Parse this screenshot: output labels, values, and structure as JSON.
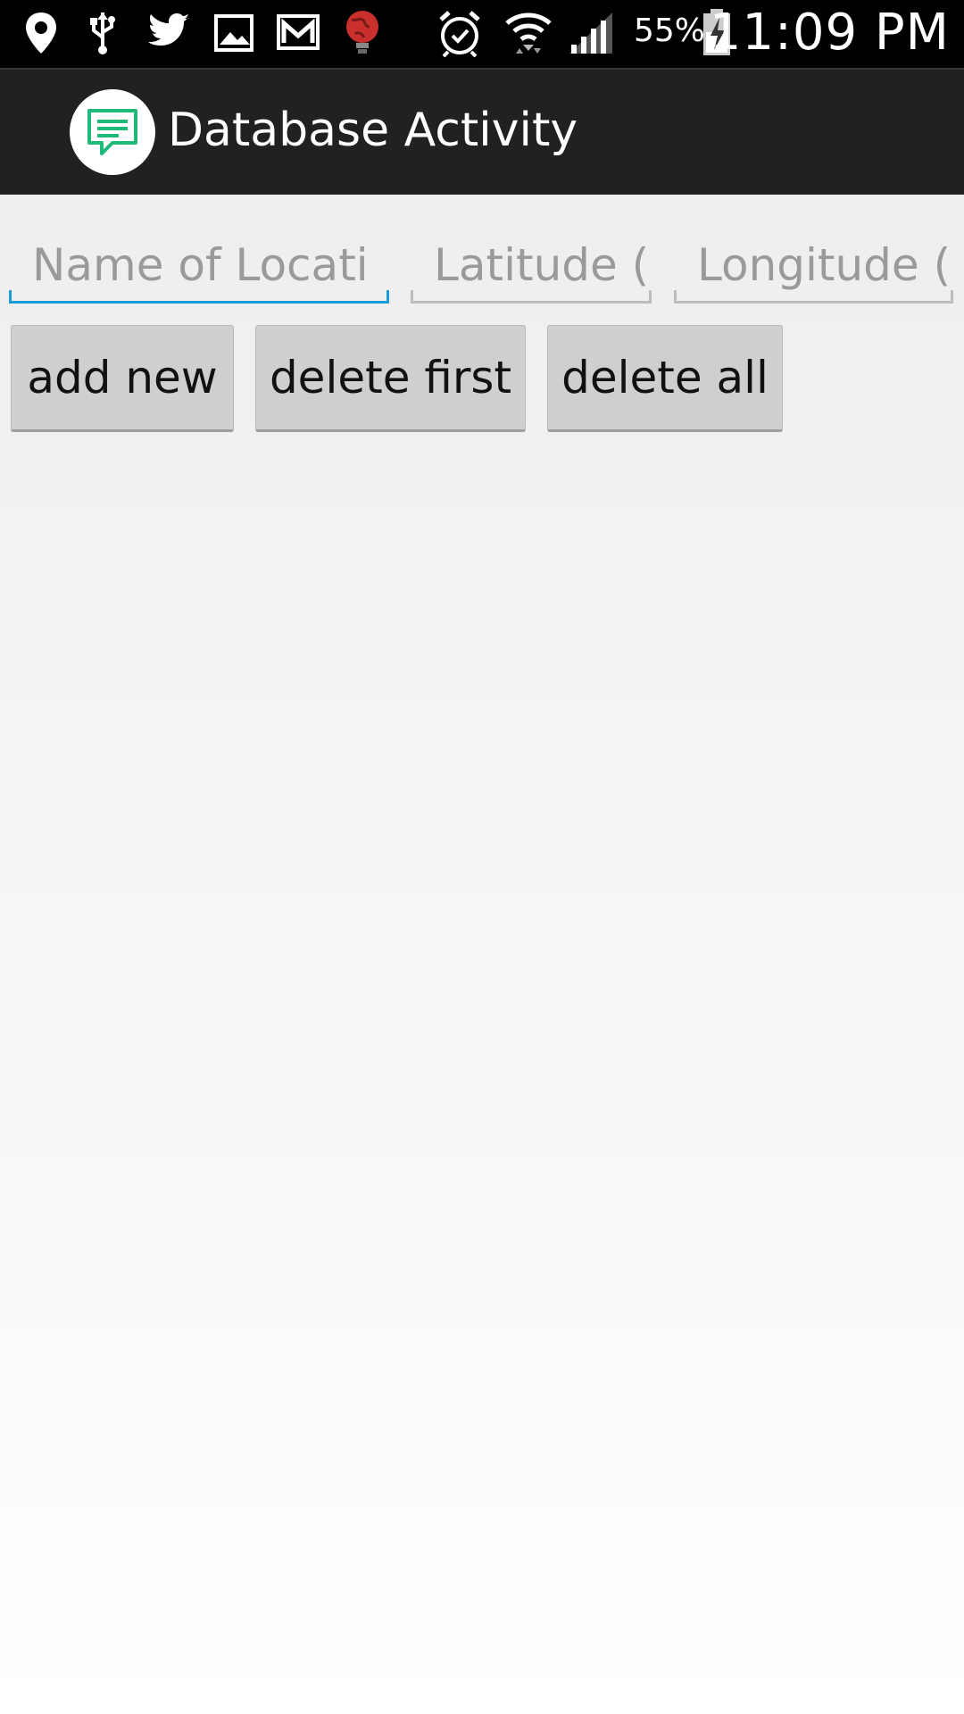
{
  "status_bar": {
    "battery_percent": "55%",
    "time": "11:09 PM",
    "icons": [
      "location-icon",
      "usb-icon",
      "twitter-icon",
      "gallery-icon",
      "gmail-icon",
      "globe-app-icon",
      "alarm-icon",
      "wifi-icon",
      "signal-icon",
      "battery-charging-icon"
    ]
  },
  "action_bar": {
    "title": "Database Activity",
    "icon": "chat-bubble-icon",
    "icon_color": "#1fb97a"
  },
  "form": {
    "name_placeholder": "Name of Locati",
    "latitude_placeholder": "Latitude (",
    "longitude_placeholder": "Longitude ("
  },
  "buttons": {
    "add_new": "add new",
    "delete_first": "delete first",
    "delete_all": "delete all"
  },
  "colors": {
    "focus_accent": "#1a9cd6",
    "action_bar_bg": "#212121",
    "status_bar_bg": "#000000"
  }
}
